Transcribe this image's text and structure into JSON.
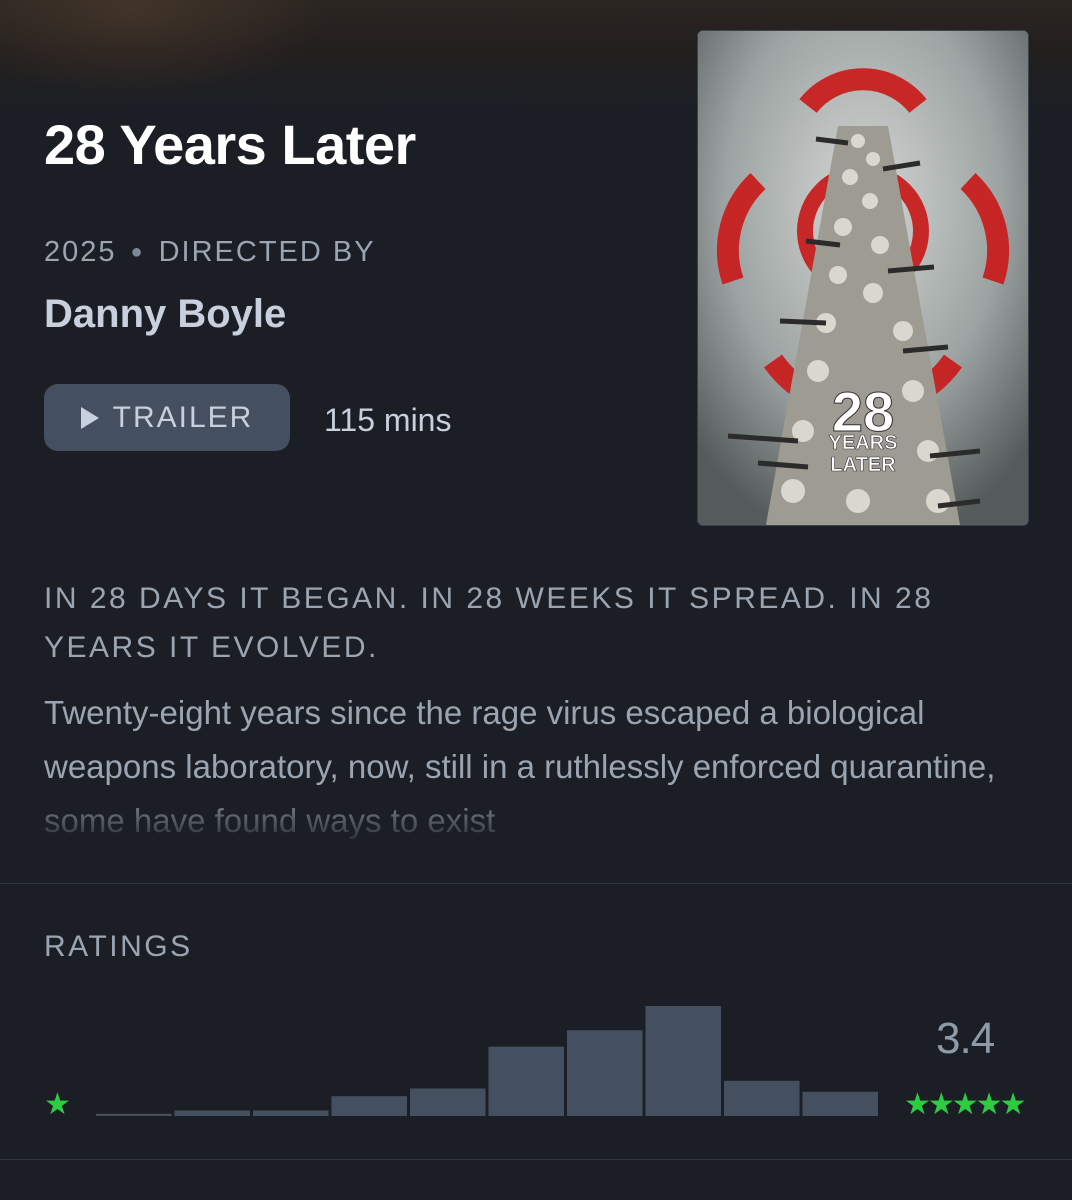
{
  "film": {
    "title": "28 Years Later",
    "year": "2025",
    "directed_by_label": "DIRECTED BY",
    "director": "Danny Boyle",
    "trailer_label": "TRAILER",
    "runtime": "115 mins",
    "tagline": "IN 28 DAYS IT BEGAN. IN 28 WEEKS IT SPREAD. IN 28 YEARS IT EVOLVED.",
    "synopsis": "Twenty-eight years since the rage virus escaped a biological weapons laboratory, now, still in a ruthlessly enforced quarantine, some have found ways to exist",
    "poster": {
      "title_line_1": "28",
      "title_line_2": "YEARS",
      "title_line_3": "LATER",
      "symbol_color": "#c8201f"
    }
  },
  "ratings": {
    "label": "RATINGS",
    "average": "3.4",
    "min_stars": "★",
    "max_stars": "★★★★★",
    "star_color": "#2ecc40",
    "bar_color": "#445060",
    "histogram_relative_heights": [
      0.02,
      0.05,
      0.05,
      0.18,
      0.25,
      0.63,
      0.78,
      1.0,
      0.32,
      0.22
    ]
  }
}
